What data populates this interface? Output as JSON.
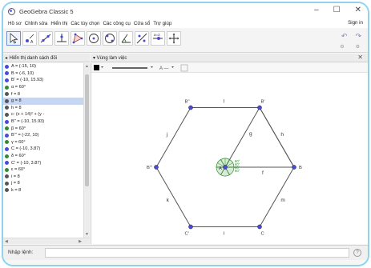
{
  "window": {
    "title": "GeoGebra Classic 5",
    "minimize_glyph": "–",
    "maximize_glyph": "☐",
    "close_glyph": "✕"
  },
  "menu": {
    "items": [
      "Hồ sơ",
      "Chỉnh sửa",
      "Hiển thị",
      "Các tùy chọn",
      "Các công cụ",
      "Cửa sổ",
      "Trợ giúp"
    ],
    "signin": "Sign in"
  },
  "toolbar": {
    "tools": [
      "move-tool",
      "point-tool",
      "line-tool",
      "perpendicular-tool",
      "polygon-tool",
      "circle-tool",
      "conic-tool",
      "angle-tool",
      "reflect-tool",
      "slider-tool",
      "move-view-tool"
    ],
    "active_tool": "move-tool",
    "undo_glyph": "↶",
    "redo_glyph": "↷",
    "extra_glyph": "⚙"
  },
  "algebra": {
    "header": "▸ Hiển thị danh sách đối",
    "rows": [
      {
        "text": "A = (-15, 10)",
        "color": "#4a4ad8"
      },
      {
        "text": "B = (-6, 10)",
        "color": "#4a4ad8"
      },
      {
        "text": "B' = (-10, 15.93)",
        "color": "#4a4ad8"
      },
      {
        "text": "α = 60°",
        "color": "#2e8b2e"
      },
      {
        "text": "f = 8",
        "color": "#555555"
      },
      {
        "text": "g = 8",
        "color": "#555555",
        "selected": true
      },
      {
        "text": "h = 8",
        "color": "#555555"
      },
      {
        "text": "c: (x + 14)² + (y -",
        "color": "#555555"
      },
      {
        "text": "B'' = (-10, 15.93)",
        "color": "#4a4ad8"
      },
      {
        "text": "β = 60°",
        "color": "#2e8b2e"
      },
      {
        "text": "B''' = (-22, 10)",
        "color": "#4a4ad8"
      },
      {
        "text": "γ = 60°",
        "color": "#2e8b2e"
      },
      {
        "text": "C = (-10, 3.87)",
        "color": "#4a4ad8"
      },
      {
        "text": "δ = 60°",
        "color": "#2e8b2e"
      },
      {
        "text": "C' = (-10, 3.87)",
        "color": "#4a4ad8"
      },
      {
        "text": "ε = 60°",
        "color": "#2e8b2e"
      },
      {
        "text": "i = 8",
        "color": "#555555"
      },
      {
        "text": "j = 8",
        "color": "#555555"
      },
      {
        "text": "k = 8",
        "color": "#555555"
      }
    ]
  },
  "graphics": {
    "header": "▾ Vùng làm việc",
    "points": [
      {
        "name": "B''",
        "label": "B''"
      },
      {
        "name": "B'",
        "label": "B'"
      },
      {
        "name": "B",
        "label": "B"
      },
      {
        "name": "C'",
        "label": "C'"
      },
      {
        "name": "C",
        "label": "C"
      },
      {
        "name": "B'''",
        "label": "B'''"
      },
      {
        "name": "A",
        "label": "A"
      }
    ],
    "segment_labels": {
      "top": "l",
      "upper_left": "j",
      "upper_right": "h",
      "lower_left": "k",
      "lower_right": "m",
      "bottom": "i",
      "diag": "g",
      "radius": "f"
    },
    "angle_labels": [
      "60°",
      "60°",
      "60°",
      "60°"
    ]
  },
  "inputbar": {
    "label": "Nhập lệnh:",
    "value": "",
    "help_glyph": "?"
  },
  "colors": {
    "point": "#4a4ad8",
    "segment": "#555555",
    "angle": "#2e8b2e",
    "selection": "#c7d7f2"
  }
}
